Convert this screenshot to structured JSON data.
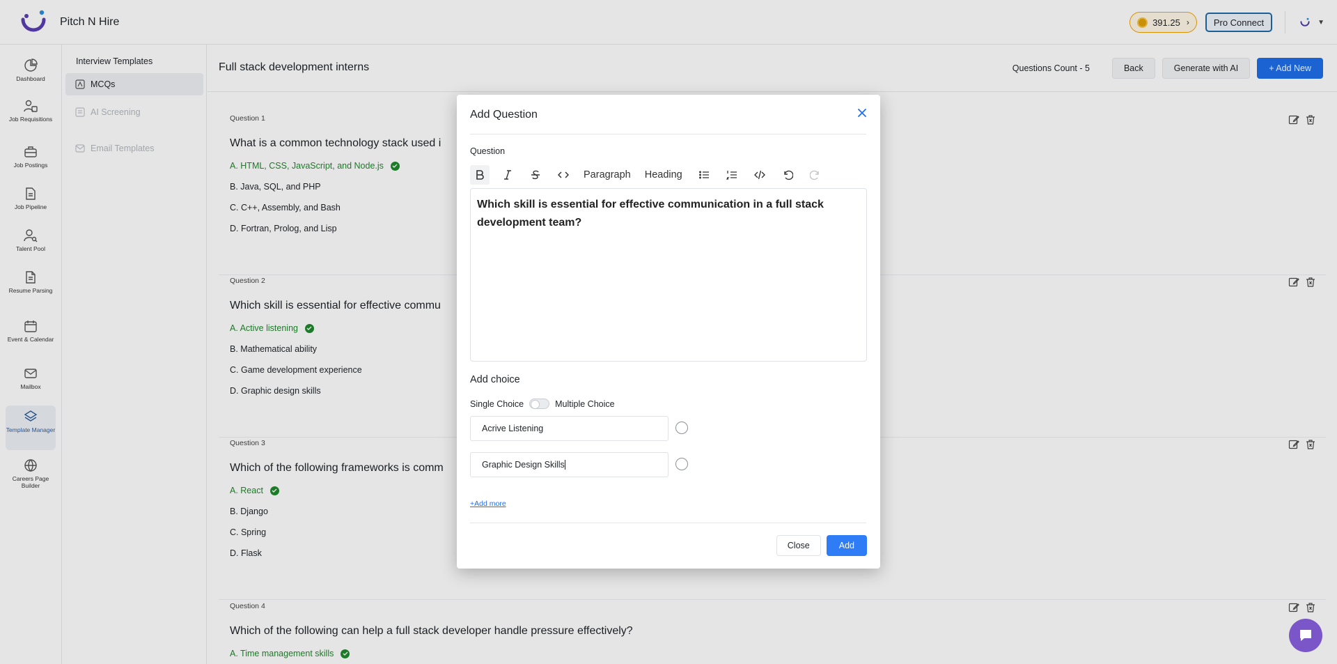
{
  "app": {
    "name": "Pitch N Hire"
  },
  "header": {
    "credits": "391.25",
    "pro_connect": "Pro Connect"
  },
  "nav": [
    {
      "label": "Dashboard",
      "icon": "dashboard-icon"
    },
    {
      "label": "Job Requisitions",
      "icon": "user-list-icon"
    },
    {
      "label": "Job Postings",
      "icon": "briefcase-icon"
    },
    {
      "label": "Job Pipeline",
      "icon": "pipeline-icon"
    },
    {
      "label": "Talent Pool",
      "icon": "user-search-icon"
    },
    {
      "label": "Resume Parsing",
      "icon": "document-icon"
    },
    {
      "label": "Event & Calendar",
      "icon": "calendar-icon"
    },
    {
      "label": "Mailbox",
      "icon": "mail-icon"
    },
    {
      "label": "Template Manager",
      "icon": "layers-icon",
      "active": true
    },
    {
      "label": "Careers Page Builder",
      "icon": "globe-icon"
    }
  ],
  "subnav": {
    "title": "Interview Templates",
    "items": [
      {
        "label": "MCQs",
        "active": true
      },
      {
        "label": "AI Screening",
        "disabled": true
      },
      {
        "label": "Email Templates",
        "disabled": true
      }
    ]
  },
  "page": {
    "title": "Full stack development interns",
    "questions_count": "Questions Count - 5",
    "back": "Back",
    "generate_ai": "Generate with AI",
    "add_new": "+ Add New"
  },
  "questions": [
    {
      "label": "Question 1",
      "text": "What is a common technology stack used i",
      "options": [
        "A. HTML, CSS, JavaScript, and Node.js",
        "B. Java, SQL, and PHP",
        "C. C++, Assembly, and Bash",
        "D. Fortran, Prolog, and Lisp"
      ]
    },
    {
      "label": "Question 2",
      "text": "Which skill is essential for effective commu",
      "options": [
        "A. Active listening",
        "B. Mathematical ability",
        "C. Game development experience",
        "D. Graphic design skills"
      ]
    },
    {
      "label": "Question 3",
      "text": "Which of the following frameworks is comm",
      "options": [
        "A. React",
        "B. Django",
        "C. Spring",
        "D. Flask"
      ]
    },
    {
      "label": "Question 4",
      "text": "Which of the following can help a full stack developer handle pressure effectively?",
      "options": [
        "A. Time management skills"
      ]
    }
  ],
  "modal": {
    "title": "Add Question",
    "question_label": "Question",
    "toolbar": {
      "paragraph": "Paragraph",
      "heading": "Heading"
    },
    "question_text": "Which skill is essential for effective communication in a full stack development team?",
    "add_choice": "Add choice",
    "single_choice": "Single Choice",
    "multiple_choice": "Multiple Choice",
    "choices": [
      "Acrive Listening",
      "Graphic Design Skills"
    ],
    "add_more": "+Add more",
    "close": "Close",
    "add": "Add"
  },
  "colors": {
    "primary": "#1f6feb",
    "correct": "#1f8a2c",
    "accent": "#7b56c8"
  }
}
